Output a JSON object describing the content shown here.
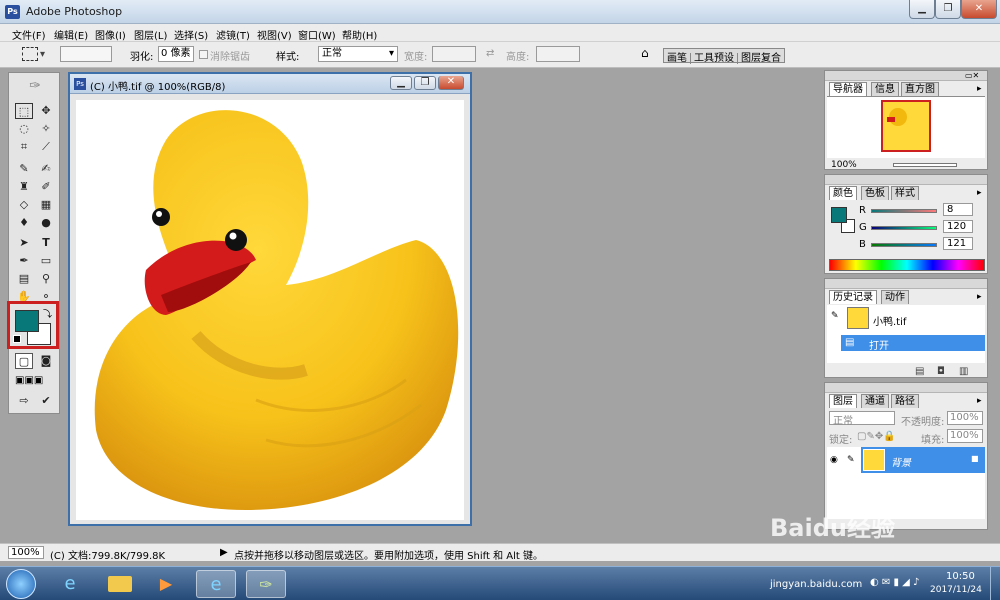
{
  "app": {
    "title": "Adobe Photoshop",
    "ps_glyph": "Ps"
  },
  "window_buttons": [
    "▁",
    "❐",
    "✕"
  ],
  "menu": [
    "文件(F)",
    "编辑(E)",
    "图像(I)",
    "图层(L)",
    "选择(S)",
    "滤镜(T)",
    "视图(V)",
    "窗口(W)",
    "帮助(H)"
  ],
  "options": {
    "feather_label": "羽化:",
    "feather_value": "0 像素",
    "antialias_label": "消除锯齿",
    "style_label": "样式:",
    "style_value": "正常",
    "width_label": "宽度:",
    "height_label": "高度:",
    "palette_tabs": [
      "画笔",
      "工具预设",
      "图层复合"
    ]
  },
  "document": {
    "title": "(C) 小鸭.tif @ 100%(RGB/8)",
    "image_alt": "rubber duck",
    "icon": "ps-document-icon"
  },
  "navigator": {
    "tabs": [
      "导航器",
      "信息",
      "直方图"
    ],
    "zoom": "100%"
  },
  "color": {
    "tabs": [
      "颜色",
      "色板",
      "样式"
    ],
    "channels": [
      {
        "label": "R",
        "value": "8"
      },
      {
        "label": "G",
        "value": "120"
      },
      {
        "label": "B",
        "value": "121"
      }
    ],
    "fg": "#087879",
    "bg": "#ffffff"
  },
  "history": {
    "tabs": [
      "历史记录",
      "动作"
    ],
    "snapshot": "小鸭.tif",
    "steps": [
      "打开"
    ]
  },
  "layers": {
    "tabs": [
      "图层",
      "通道",
      "路径"
    ],
    "blend": "正常",
    "opacity_label": "不透明度:",
    "opacity_value": "100%",
    "lock_label": "锁定:",
    "fill_label": "填充:",
    "fill_value": "100%",
    "layer_name": "背景"
  },
  "status": {
    "zoom": "100%",
    "doc_info": "(C) 文档:799.8K/799.8K",
    "hint": "点按并拖移以移动图层或选区。要用附加选项，使用 Shift 和 Alt 键。"
  },
  "taskbar": {
    "time": "10:50",
    "date": "2017/11/24"
  },
  "watermark": {
    "text": "Baidu经验",
    "url": "jingyan.baidu.com"
  },
  "colors": {
    "highlight": "#cc1f1f",
    "selection": "#3f8ee8"
  }
}
